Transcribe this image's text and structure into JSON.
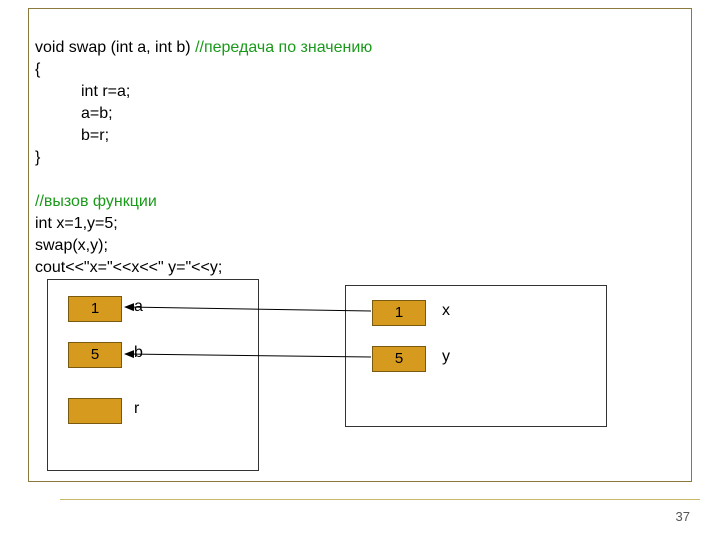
{
  "code": {
    "line1_code": "void swap (int a, int b) ",
    "line1_comment": "//передача по значению",
    "line2": "{",
    "line3": "int r=a;",
    "line4": "a=b;",
    "line5": "b=r;",
    "line6": "}",
    "line8_comment": "//вызов функции",
    "line9": "int x=1,y=5;",
    "line10": "swap(x,y);",
    "line11": "cout<<\"x=\"<<x<<\" y=\"<<y;"
  },
  "left_box": {
    "a": {
      "value": "1",
      "label": "a"
    },
    "b": {
      "value": "5",
      "label": "b"
    },
    "r": {
      "value": "",
      "label": "r"
    }
  },
  "right_box": {
    "x": {
      "value": "1",
      "label": "x"
    },
    "y": {
      "value": "5",
      "label": "y"
    }
  },
  "page_number": "37"
}
